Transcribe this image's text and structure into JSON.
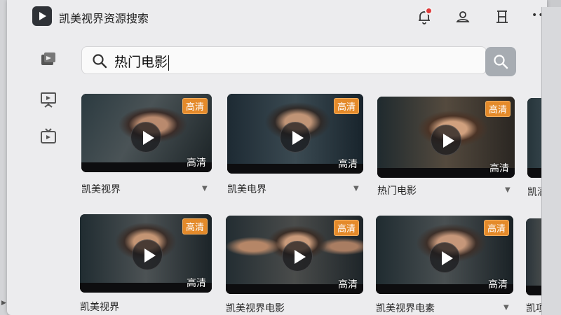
{
  "app": {
    "title": "凯美视界资源搜索"
  },
  "titlebar_icons": [
    "bell-icon",
    "user-icon",
    "frame-icon",
    "more-icon"
  ],
  "search": {
    "query": "热门电影"
  },
  "hd_label": "高清",
  "row1": [
    {
      "caption": "凯美视界"
    },
    {
      "caption": "凯美电界"
    },
    {
      "caption": "热门电影"
    },
    {
      "caption": "凯满视界"
    }
  ],
  "row2": [
    {
      "caption": "凯美视界"
    },
    {
      "caption": "凯美视界电影"
    },
    {
      "caption": "凯美视界电素"
    },
    {
      "caption": "凯项"
    }
  ],
  "colors": {
    "accent": "#e48a2a",
    "badge": "#e03a3a",
    "search_button": "#a7acb2"
  }
}
